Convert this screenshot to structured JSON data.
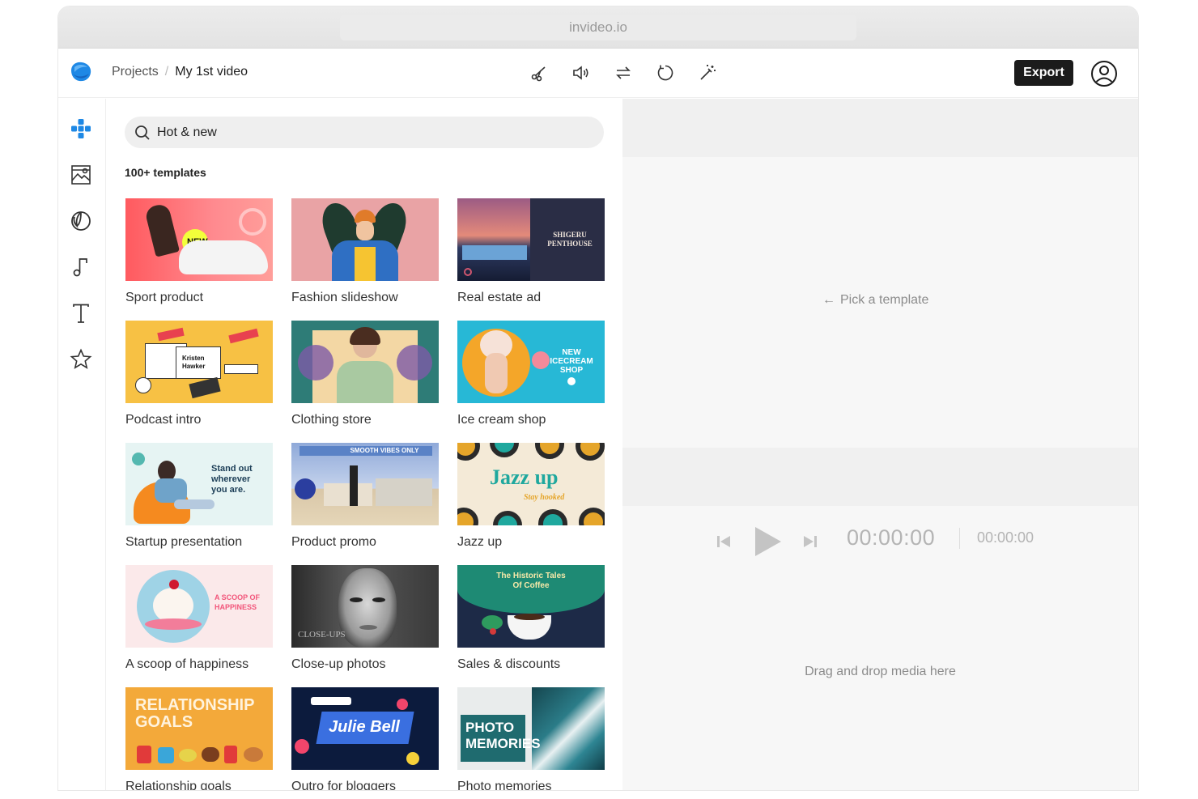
{
  "browser": {
    "url": "invideo.io"
  },
  "header": {
    "breadcrumb": {
      "root": "Projects",
      "separator": "/",
      "current": "My 1st video"
    },
    "tools": [
      {
        "icon": "scissors-icon"
      },
      {
        "icon": "volume-icon"
      },
      {
        "icon": "swap-icon"
      },
      {
        "icon": "rotate-icon"
      },
      {
        "icon": "magic-wand-icon"
      }
    ],
    "export_label": "Export",
    "account_icon": "user-circle-icon"
  },
  "rail": {
    "items": [
      {
        "icon": "templates-icon",
        "active": true
      },
      {
        "icon": "media-icon"
      },
      {
        "icon": "stickers-icon"
      },
      {
        "icon": "music-icon"
      },
      {
        "icon": "text-icon"
      },
      {
        "icon": "favorites-icon"
      }
    ]
  },
  "panel": {
    "search_value": "Hot & new",
    "count_label": "100+ templates",
    "templates": [
      {
        "label": "Sport product",
        "badge": "NEW"
      },
      {
        "label": "Fashion slideshow"
      },
      {
        "label": "Real estate ad",
        "caption": "SHIGERU PENTHOUSE"
      },
      {
        "label": "Podcast intro",
        "caption": "Kristen Hawker"
      },
      {
        "label": "Clothing store"
      },
      {
        "label": "Ice cream shop",
        "caption": "NEW ICECREAM SHOP"
      },
      {
        "label": "Startup presentation",
        "caption": "Stand out wherever you are."
      },
      {
        "label": "Product promo",
        "caption": "SMOOTH VIBES ONLY"
      },
      {
        "label": "Jazz up",
        "caption": "Jazz up",
        "subcaption": "Stay hooked"
      },
      {
        "label": "A scoop of happiness",
        "caption": "A SCOOP OF HAPPINESS"
      },
      {
        "label": "Close-up photos",
        "caption": "CLOSE-UPS"
      },
      {
        "label": "Sales & discounts",
        "caption": "The Historic Tales Of Coffee"
      },
      {
        "label": "Relationship goals",
        "caption": "RELATIONSHIP GOALS"
      },
      {
        "label": "Outro for bloggers",
        "caption": "Julie Bell"
      },
      {
        "label": "Photo memories",
        "caption": "PHOTO MEMORIES"
      }
    ]
  },
  "preview": {
    "hint": "Pick a template",
    "timecode": "00:00:00",
    "duration": "00:00:00",
    "drop_hint": "Drag and drop media here"
  },
  "colors": {
    "accent": "#1e88e5",
    "export_bg": "#1b1b1b"
  }
}
